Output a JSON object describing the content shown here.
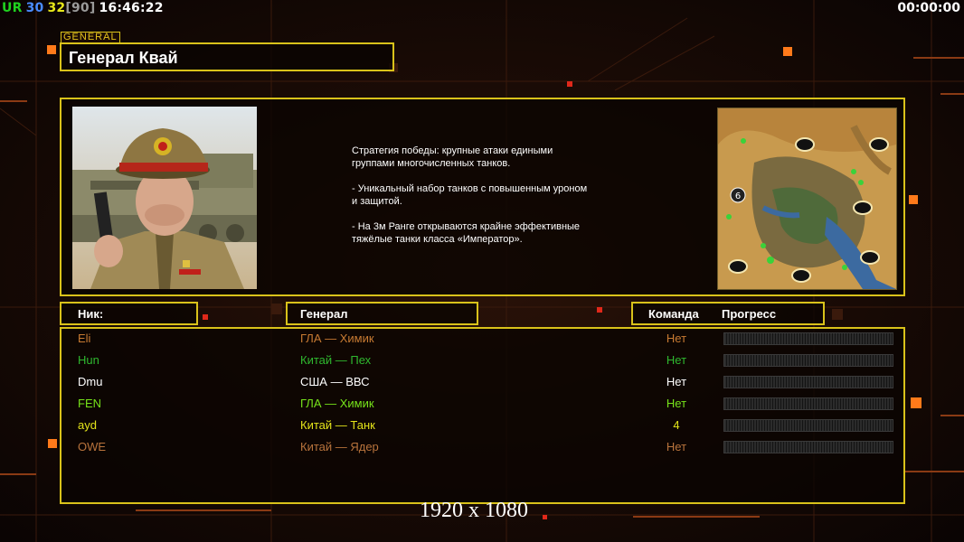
{
  "hud": {
    "ur": "UR",
    "ur_val": "30",
    "num1": "32",
    "num2": "[90]",
    "clock": "16:46:22",
    "timer": "00:00:00",
    "colors": {
      "ur": "#1fd21f",
      "ur_val": "#4a8cff",
      "num1": "#e8e81a",
      "num2": "#9a9a9a"
    }
  },
  "general": {
    "tag": "GENERAL",
    "name": "Генерал Квай",
    "description": [
      "Стратегия победы: крупные атаки едиными\n группами многочисленных танков.",
      "- Уникальный набор танков с повышенным уроном\n и защитой.",
      "- На 3м Ранге открываются крайне эффективные\n тяжёлые танки класса «Император»."
    ],
    "portrait_icon": "general-kwai-portrait",
    "map_icon": "desert-minimap",
    "map_player_count": "6"
  },
  "table": {
    "headers": {
      "nick": "Ник:",
      "general": "Генерал",
      "team": "Команда",
      "progress": "Прогресс"
    },
    "rows": [
      {
        "nick": "Eli",
        "general": "ГЛА — Химик",
        "team": "Нет",
        "color": "#c77a32"
      },
      {
        "nick": "Hun",
        "general": "Китай — Пех",
        "team": "Нет",
        "color": "#2fb82f"
      },
      {
        "nick": "Dmu",
        "general": "США — ВВС",
        "team": "Нет",
        "color": "#ffffff"
      },
      {
        "nick": "FEN",
        "general": "ГЛА — Химик",
        "team": "Нет",
        "color": "#76e21a"
      },
      {
        "nick": "ayd",
        "general": "Китай — Танк",
        "team": "4",
        "color": "#e3e31a"
      },
      {
        "nick": "OWE",
        "general": "Китай — Ядер",
        "team": "Нет",
        "color": "#b8733c"
      }
    ]
  },
  "footer": {
    "resolution": "1920 x 1080"
  }
}
